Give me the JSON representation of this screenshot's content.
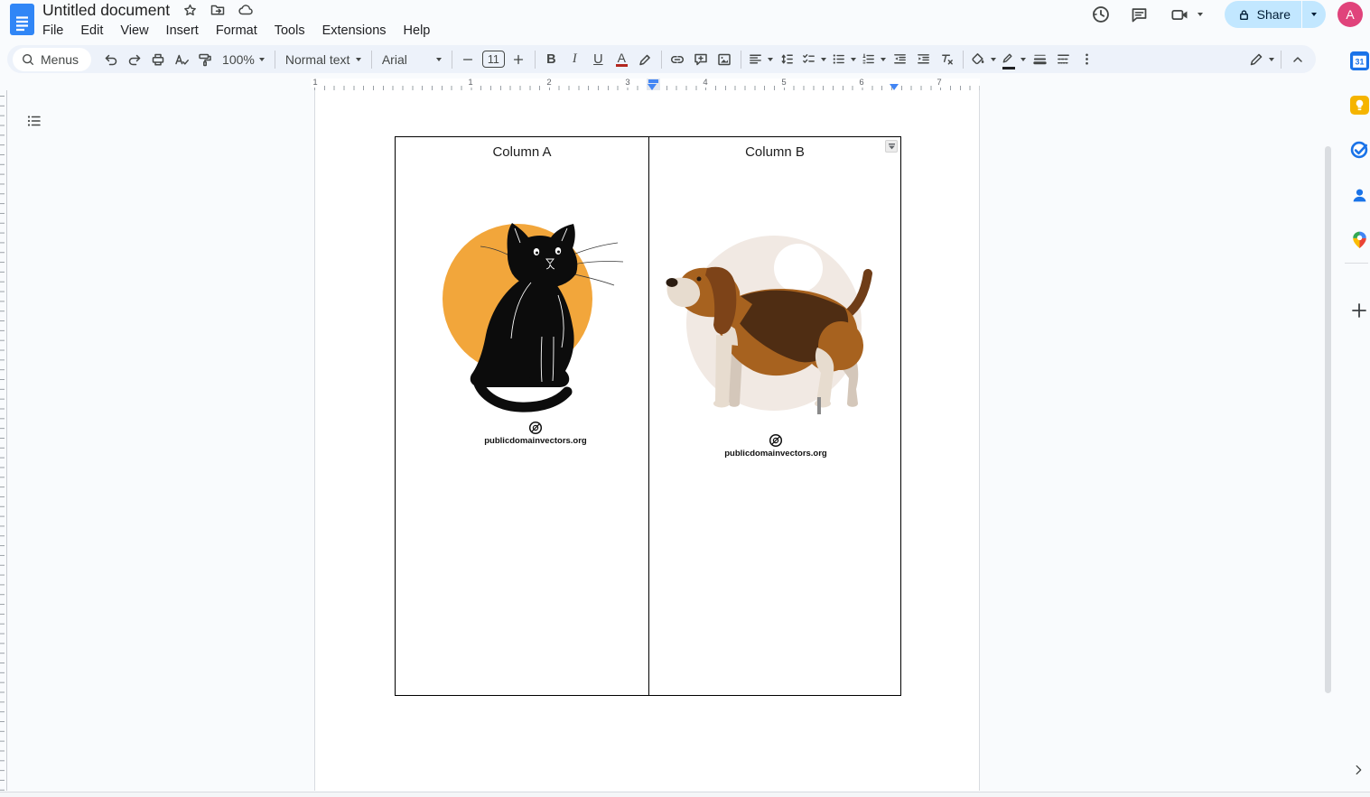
{
  "header": {
    "title": "Untitled document",
    "menu": [
      "File",
      "Edit",
      "View",
      "Insert",
      "Format",
      "Tools",
      "Extensions",
      "Help"
    ],
    "share_label": "Share",
    "avatar_letter": "A"
  },
  "toolbar": {
    "menus_label": "Menus",
    "zoom": "100%",
    "paragraph_style": "Normal text",
    "font": "Arial",
    "font_size": "11",
    "bold_label": "B",
    "italic_label": "I",
    "underline_label": "U",
    "text_color_label": "A"
  },
  "ruler": {
    "numbers": [
      "1",
      "1",
      "2",
      "3",
      "4",
      "5",
      "6",
      "7"
    ]
  },
  "document": {
    "table": {
      "columns": [
        {
          "header": "Column A"
        },
        {
          "header": "Column B"
        }
      ]
    },
    "figures": [
      {
        "name": "black-cat-illustration",
        "caption": "publicdomainvectors.org"
      },
      {
        "name": "beagle-dog-illustration",
        "caption": "publicdomainvectors.org"
      }
    ]
  },
  "rail": {
    "calendar_label": "31"
  },
  "colors": {
    "toolbar_bg": "#edf2fa",
    "share_bg": "#c2e7ff",
    "share_text": "#001d35",
    "avatar_bg": "#e0437b",
    "accent_blue": "#4285f4",
    "cat_circle": "#f2a63b",
    "dog_circle": "#f1e9e3"
  }
}
